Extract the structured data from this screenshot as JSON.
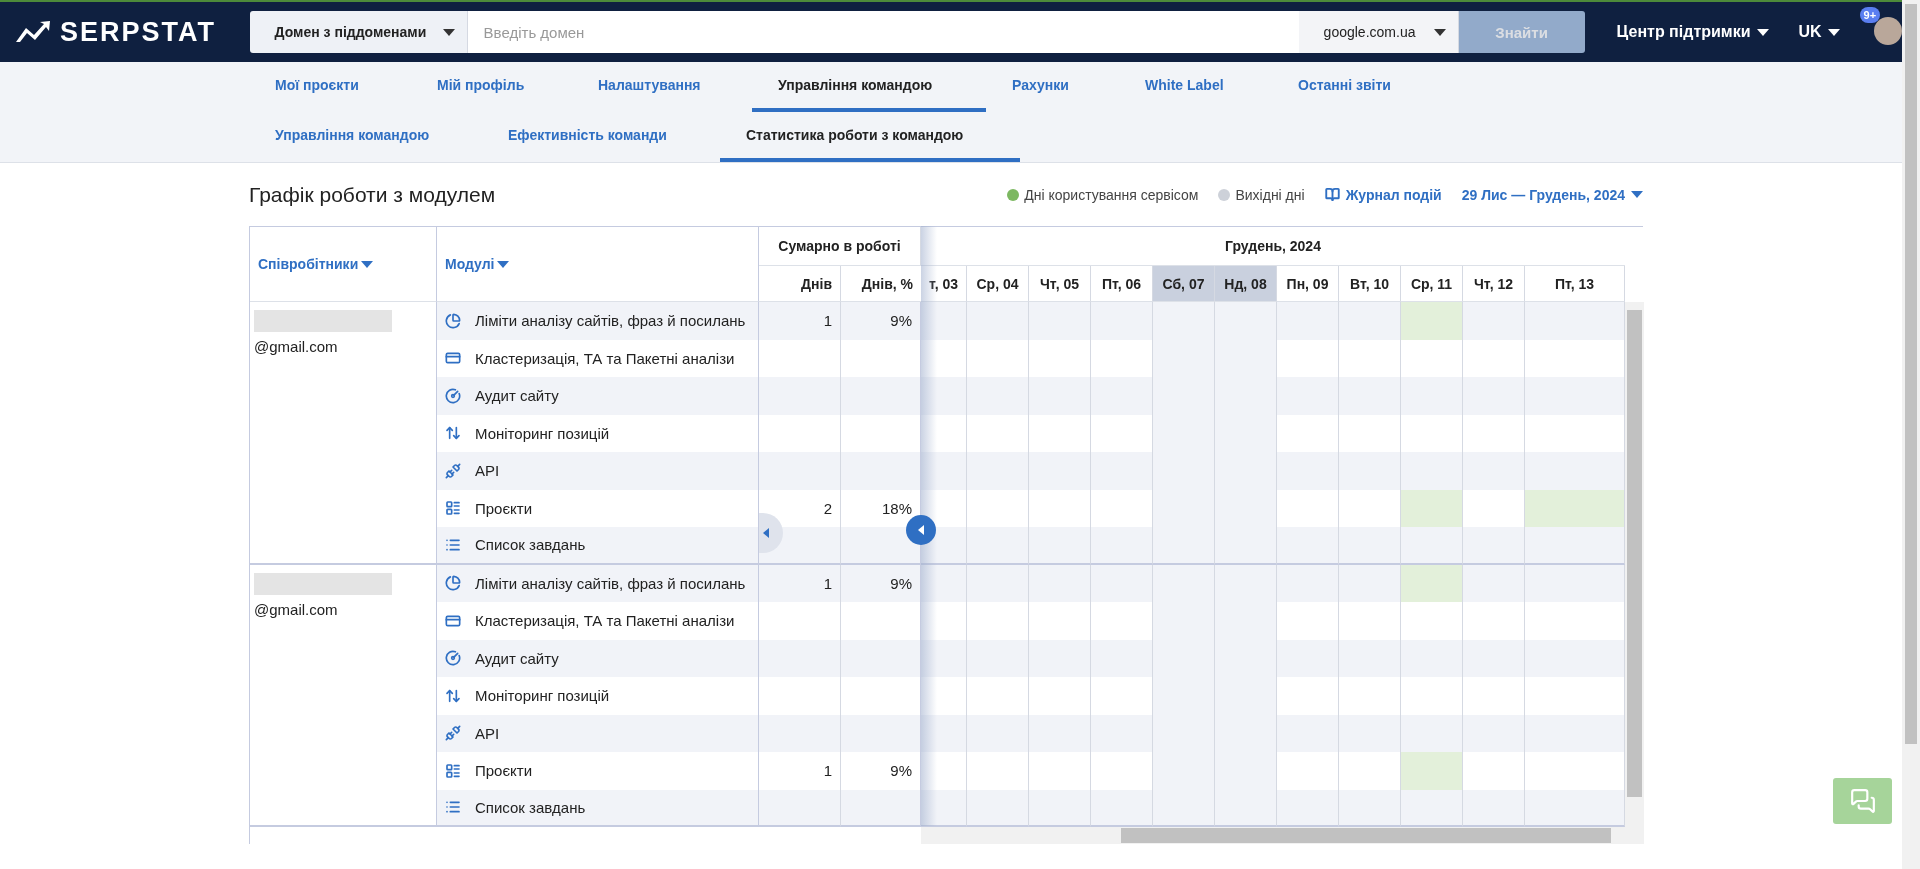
{
  "header": {
    "logo": "SERPSTAT",
    "search_type": "Домен з піддоменами",
    "domain_placeholder": "Введіть домен",
    "region": "google.com.ua",
    "search_button": {
      "label": "Знайти",
      "disabled": true
    },
    "support": "Центр підтримки",
    "language": "UK",
    "notifications": "9+"
  },
  "nav_tabs": [
    {
      "label": "Мої проєкти",
      "selected": false
    },
    {
      "label": "Мій профіль",
      "selected": false
    },
    {
      "label": "Налаштування",
      "selected": false
    },
    {
      "label": "Управління командою",
      "selected": true
    },
    {
      "label": "Рахунки",
      "selected": false
    },
    {
      "label": "White Label",
      "selected": false
    },
    {
      "label": "Останні звіти",
      "selected": false
    }
  ],
  "sub_tabs": [
    {
      "label": "Управління командою",
      "selected": false
    },
    {
      "label": "Ефективність команди",
      "selected": false
    },
    {
      "label": "Статистика роботи з командою",
      "selected": true
    }
  ],
  "title": "Графік роботи з модулем",
  "legend": [
    {
      "label": "Дні користування сервісом",
      "color": "#7cb861"
    },
    {
      "label": "Вихідні дні",
      "color": "#cdd1d9"
    }
  ],
  "journal_link": "Журнал подій",
  "date_range": "29 Лис — Грудень, 2024",
  "table": {
    "employees_header": "Співробітники",
    "modules_header": "Модулі",
    "totals_header": "Сумарно в роботі",
    "days_header": "Днів",
    "percent_header": "Днів, %",
    "month": "Грудень, 2024",
    "days": [
      {
        "label": "т, 03",
        "weekend": false
      },
      {
        "label": "Ср, 04",
        "weekend": false
      },
      {
        "label": "Чт, 05",
        "weekend": false
      },
      {
        "label": "Пт, 06",
        "weekend": false
      },
      {
        "label": "Сб, 07",
        "weekend": true
      },
      {
        "label": "Нд, 08",
        "weekend": true
      },
      {
        "label": "Пн, 09",
        "weekend": false
      },
      {
        "label": "Вт, 10",
        "weekend": false
      },
      {
        "label": "Ср, 11",
        "weekend": false
      },
      {
        "label": "Чт, 12",
        "weekend": false
      },
      {
        "label": "Пт, 13",
        "weekend": false
      }
    ],
    "employees": [
      {
        "email_end": "@gmail.com",
        "modules": [
          {
            "kind": "limits",
            "name": "Ліміти аналізу сайтів, фраз й посилань",
            "days": "1",
            "percent": "9%",
            "activity": [
              false,
              false,
              false,
              false,
              false,
              false,
              false,
              false,
              true,
              false,
              false
            ]
          },
          {
            "kind": "clustering",
            "name": "Кластеризація, ТА та Пакетні аналізи",
            "activity": [
              false,
              false,
              false,
              false,
              false,
              false,
              false,
              false,
              false,
              false,
              false
            ]
          },
          {
            "kind": "audit",
            "name": "Аудит сайту",
            "activity": [
              false,
              false,
              false,
              false,
              false,
              false,
              false,
              false,
              false,
              false,
              false
            ]
          },
          {
            "kind": "monitoring",
            "name": "Моніторинг позицій",
            "activity": [
              false,
              false,
              false,
              false,
              false,
              false,
              false,
              false,
              false,
              false,
              false
            ]
          },
          {
            "kind": "api",
            "name": "API",
            "activity": [
              false,
              false,
              false,
              false,
              false,
              false,
              false,
              false,
              false,
              false,
              false
            ]
          },
          {
            "kind": "projects",
            "name": "Проєкти",
            "days": "2",
            "percent": "18%",
            "activity": [
              false,
              false,
              false,
              false,
              false,
              false,
              false,
              false,
              true,
              false,
              true
            ]
          },
          {
            "kind": "tasks",
            "name": "Список завдань",
            "activity": [
              false,
              false,
              false,
              false,
              false,
              false,
              false,
              false,
              false,
              false,
              false
            ]
          }
        ]
      },
      {
        "email_end": "@gmail.com",
        "modules": [
          {
            "kind": "limits",
            "name": "Ліміти аналізу сайтів, фраз й посилань",
            "days": "1",
            "percent": "9%",
            "activity": [
              false,
              false,
              false,
              false,
              false,
              false,
              false,
              false,
              true,
              false,
              false
            ]
          },
          {
            "kind": "clustering",
            "name": "Кластеризація, ТА та Пакетні аналізи",
            "activity": [
              false,
              false,
              false,
              false,
              false,
              false,
              false,
              false,
              false,
              false,
              false
            ]
          },
          {
            "kind": "audit",
            "name": "Аудит сайту",
            "activity": [
              false,
              false,
              false,
              false,
              false,
              false,
              false,
              false,
              false,
              false,
              false
            ]
          },
          {
            "kind": "monitoring",
            "name": "Моніторинг позицій",
            "activity": [
              false,
              false,
              false,
              false,
              false,
              false,
              false,
              false,
              false,
              false,
              false
            ]
          },
          {
            "kind": "api",
            "name": "API",
            "activity": [
              false,
              false,
              false,
              false,
              false,
              false,
              false,
              false,
              false,
              false,
              false
            ]
          },
          {
            "kind": "projects",
            "name": "Проєкти",
            "days": "1",
            "percent": "9%",
            "activity": [
              false,
              false,
              false,
              false,
              false,
              false,
              false,
              false,
              true,
              false,
              false
            ]
          },
          {
            "kind": "tasks",
            "name": "Список завдань",
            "activity": [
              false,
              false,
              false,
              false,
              false,
              false,
              false,
              false,
              false,
              false,
              false
            ]
          }
        ]
      }
    ]
  }
}
